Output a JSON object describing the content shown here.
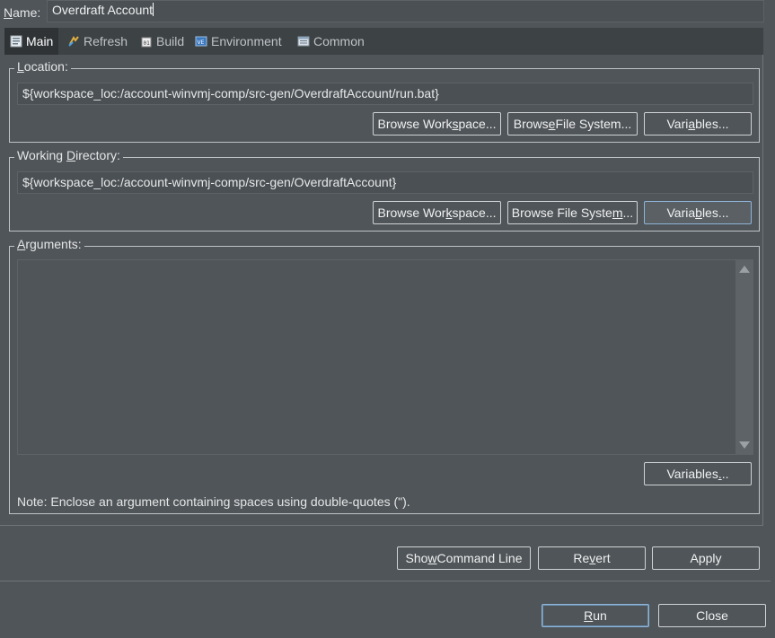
{
  "name_row": {
    "label_prefix": "N",
    "label_rest": "ame:",
    "value": "Overdraft Account"
  },
  "tabs": [
    {
      "label": "Main",
      "icon": "main-tab-icon",
      "active": true
    },
    {
      "label": "Refresh",
      "icon": "refresh-icon",
      "active": false
    },
    {
      "label": "Build",
      "icon": "build-icon",
      "active": false
    },
    {
      "label": "Environment",
      "icon": "environment-icon",
      "active": false
    },
    {
      "label": "Common",
      "icon": "common-icon",
      "active": false
    }
  ],
  "location": {
    "legend_u": "L",
    "legend_rest": "ocation:",
    "value": "${workspace_loc:/account-winvmj-comp/src-gen/OverdraftAccount/run.bat}",
    "browse_workspace": {
      "pre": "Browse Work",
      "u": "s",
      "post": "pace..."
    },
    "browse_fs": {
      "pre": "Brows",
      "u": "e",
      "post": " File System..."
    },
    "variables": {
      "pre": "Vari",
      "u": "a",
      "post": "bles..."
    }
  },
  "working_dir": {
    "legend_pre": "Working ",
    "legend_u": "D",
    "legend_post": "irectory:",
    "value": "${workspace_loc:/account-winvmj-comp/src-gen/OverdraftAccount}",
    "browse_workspace": {
      "pre": "Browse Wor",
      "u": "k",
      "post": "space..."
    },
    "browse_fs": {
      "pre": "Browse File Syste",
      "u": "m",
      "post": "..."
    },
    "variables": {
      "pre": "Varia",
      "u": "b",
      "post": "les..."
    }
  },
  "arguments": {
    "legend_u": "A",
    "legend_rest": "rguments:",
    "value": "",
    "variables": {
      "pre": "Variables",
      "u": ".",
      "post": ".."
    },
    "note": "Note: Enclose an argument containing spaces using double-quotes (\")."
  },
  "actions": {
    "show_cmd": {
      "pre": "Sho",
      "u": "w",
      "post": " Command Line"
    },
    "revert": {
      "pre": "Re",
      "u": "v",
      "post": "ert"
    },
    "apply": {
      "pre": "Apply",
      "u": "",
      "post": ""
    }
  },
  "footer": {
    "run": {
      "pre": "",
      "u": "R",
      "post": "un"
    },
    "close": {
      "pre": "Close",
      "u": "",
      "post": ""
    }
  },
  "colors": {
    "background": "#4f5559",
    "tab_active": "#2f3336",
    "focus_border": "#8fb4d8"
  }
}
